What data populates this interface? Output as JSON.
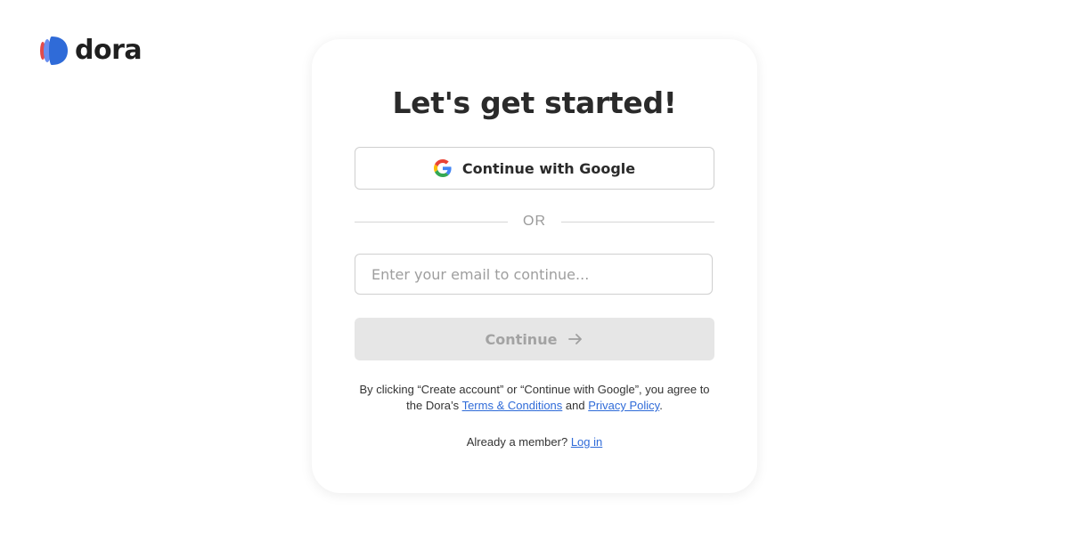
{
  "brand": {
    "name": "dora",
    "colors": {
      "primary": "#2f6bd8",
      "accent": "#e24b4b"
    }
  },
  "signup": {
    "title": "Let's get started!",
    "google_button_label": "Continue with Google",
    "or_label": "OR",
    "email_placeholder": "Enter your email to continue...",
    "email_value": "",
    "continue_label": "Continue",
    "terms_prefix": "By clicking “Create account” or “Continue with Google”, you agree to the Dora’s",
    "terms_link": "Terms & Conditions",
    "terms_and": "and",
    "privacy_link": "Privacy Policy",
    "terms_suffix": ".",
    "member_text": "Already a member?",
    "login_link": "Log in"
  },
  "icons": {
    "logo": "dora-logo-icon",
    "google": "google-icon",
    "arrow": "arrow-right-icon"
  }
}
